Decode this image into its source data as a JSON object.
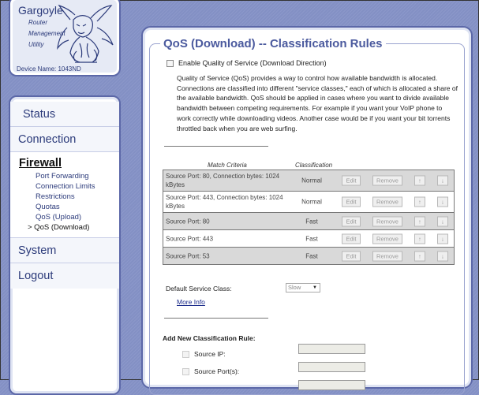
{
  "header": {
    "app_name": "Gargoyle",
    "subtitle_lines": [
      "Router",
      "Management",
      "Utility"
    ],
    "device_name": "Device Name: 1043ND"
  },
  "sidebar": {
    "sections": {
      "status": "Status",
      "connection": "Connection",
      "firewall": "Firewall",
      "system": "System",
      "logout": "Logout"
    },
    "firewall_items": [
      {
        "label": "Port Forwarding"
      },
      {
        "label": "Connection Limits"
      },
      {
        "label": "Restrictions"
      },
      {
        "label": "Quotas"
      },
      {
        "label": "QoS (Upload)"
      },
      {
        "label": "> QoS (Download)"
      }
    ]
  },
  "main": {
    "title": "QoS (Download) -- Classification Rules",
    "enable_label": "Enable Quality of Service (Download Direction)",
    "description": "Quality of Service (QoS) provides a way to control how available bandwidth is allocated. Connections are classified into different \"service classes,\" each of which is allocated a share of the available bandwidth. QoS should be applied in cases where you want to divide available bandwidth between competing requirements. For example if you want your VoIP phone to work correctly while downloading videos. Another case would be if you want your bit torrents throttled back when you are web surfing.",
    "table": {
      "headers": {
        "criteria": "Match Criteria",
        "classification": "Classification"
      },
      "button_labels": {
        "edit": "Edit",
        "remove": "Remove",
        "up": "↑",
        "down": "↓"
      },
      "rows": [
        {
          "criteria": "Source Port: 80, Connection bytes: 1024 kBytes",
          "classification": "Normal"
        },
        {
          "criteria": "Source Port: 443, Connection bytes: 1024 kBytes",
          "classification": "Normal"
        },
        {
          "criteria": "Source Port: 80",
          "classification": "Fast"
        },
        {
          "criteria": "Source Port: 443",
          "classification": "Fast"
        },
        {
          "criteria": "Source Port: 53",
          "classification": "Fast"
        }
      ]
    },
    "default_class_label": "Default Service Class:",
    "default_class_value": "Slow",
    "more_info": "More Info",
    "add_rule_title": "Add New Classification Rule:",
    "fields": [
      {
        "label": "Source IP:"
      },
      {
        "label": "Source Port(s):"
      }
    ]
  }
}
